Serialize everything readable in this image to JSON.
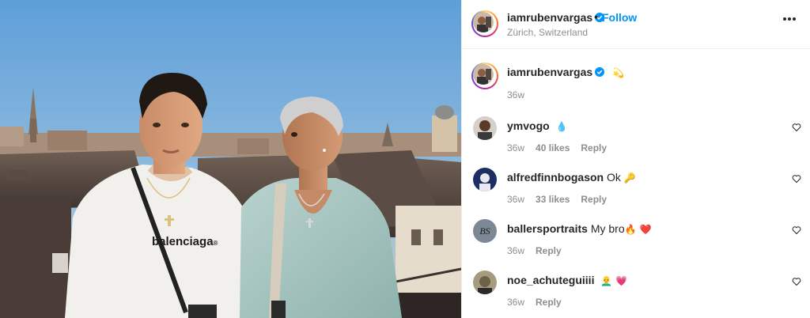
{
  "post": {
    "username": "iamrubenvargas",
    "dot": "•",
    "follow_label": "Follow",
    "location": "Zürich, Switzerland",
    "caption_emoji": "💫",
    "caption_time": "36w",
    "more_icon": "more-options-icon",
    "print_on_shirt": "balenciaga",
    "print_registered": "®"
  },
  "comments": [
    {
      "username": "ymvogo",
      "text": "",
      "emoji": "💧",
      "time": "36w",
      "likes": "40 likes",
      "reply": "Reply",
      "avatar_color": "#5b3a2a"
    },
    {
      "username": "alfredfinnbogason",
      "text": "Ok",
      "emoji": "🔑",
      "time": "36w",
      "likes": "33 likes",
      "reply": "Reply",
      "avatar_color": "#1d2e63"
    },
    {
      "username": "ballersportraits",
      "text": "My bro",
      "emoji": "🔥",
      "emoji2": "❤️",
      "time": "36w",
      "likes": "",
      "reply": "Reply",
      "avatar_color": "#7d8896",
      "avatar_text": "BS"
    },
    {
      "username": "noe_achuteguiiii",
      "text": "",
      "emoji": "👨‍🦲",
      "emoji2": "💗",
      "time": "36w",
      "likes": "",
      "reply": "Reply",
      "avatar_color": "#6b6247"
    }
  ],
  "colors": {
    "link": "#0095f6",
    "muted": "#8e8e8e",
    "text": "#262626",
    "divider": "#efefef"
  }
}
